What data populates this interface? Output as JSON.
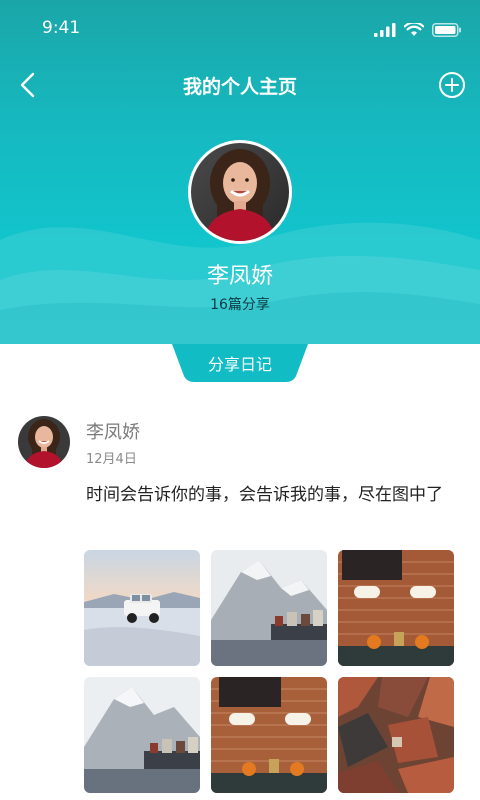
{
  "status": {
    "time": "9:41"
  },
  "nav": {
    "title": "我的个人主页",
    "back_icon": "chevron-left-icon",
    "add_icon": "plus-circle-icon"
  },
  "profile": {
    "name": "李凤娇",
    "count_text": "16篇分享"
  },
  "tab": {
    "label": "分享日记"
  },
  "post": {
    "author": "李凤娇",
    "date": "12月4日",
    "text": "时间会告诉你的事，会告诉我的事，尽在图中了",
    "photos": [
      {
        "subject": "jeep-on-snow"
      },
      {
        "subject": "mountain-lake-village"
      },
      {
        "subject": "brick-wall-cafe"
      },
      {
        "subject": "mountain-lake-village"
      },
      {
        "subject": "brick-wall-cafe"
      },
      {
        "subject": "aerial-city"
      }
    ]
  },
  "colors": {
    "header_top": "#1aa6a8",
    "header_bottom": "#10c6cc",
    "accent": "#16b5bb",
    "text_main": "#222222",
    "text_muted": "#8a8a8a"
  }
}
